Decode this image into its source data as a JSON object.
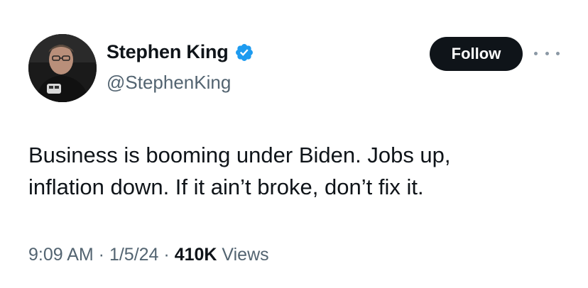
{
  "author": {
    "display_name": "Stephen King",
    "handle": "@StephenKing",
    "verified": true,
    "verified_color": "#1d9bf0",
    "avatar_icon": "profile-photo"
  },
  "actions": {
    "follow_label": "Follow",
    "more_icon": "ellipsis-icon"
  },
  "tweet": {
    "text": "Business is booming under Biden. Jobs up,\ninflation down. If it ain’t broke, don’t fix it."
  },
  "meta": {
    "time": "9:09 AM",
    "separator": " · ",
    "date": "1/5/24",
    "views_count": "410K",
    "views_label": " Views"
  }
}
